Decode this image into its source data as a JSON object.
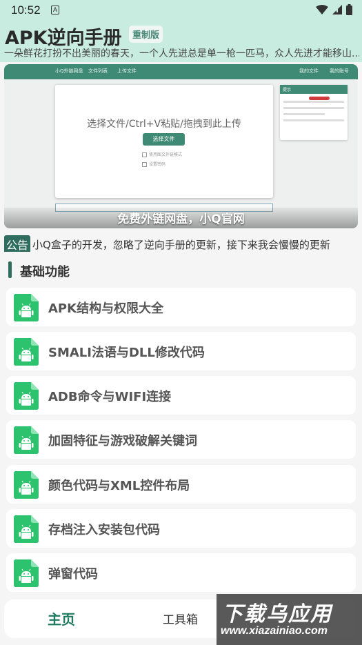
{
  "status_bar": {
    "time": "10:52",
    "notification_glyph": "A",
    "icons": [
      "wifi-icon",
      "signal-icon",
      "battery-icon"
    ]
  },
  "app": {
    "title": "APK逆向手册",
    "badge": "重制版"
  },
  "marquee": "一朵鲜花打扮不出美丽的春天，一个人先进总是单一枪一匹马，众人先进才能移山...",
  "banner": {
    "nav_items": [
      "小Q外链网盘",
      "文件列表",
      "上传文件",
      "我的文件",
      "我的账号"
    ],
    "upload_prompt": "选择文件/Ctrl+V粘贴/拖拽到此上传",
    "upload_button": "选择文件",
    "checkbox_1": "使用图文外链模式",
    "checkbox_2": "设置密码",
    "tip_title": "提示",
    "caption": "免费外链网盘，小Q官网"
  },
  "notice": {
    "tag": "公告",
    "text": "小Q盒子的开发，忽略了逆向手册的更新，接下来我会慢慢的更新"
  },
  "section": {
    "title": "基础功能"
  },
  "features": [
    {
      "label": "APK结构与权限大全",
      "icon": "android-file-icon"
    },
    {
      "label": "SMALI法语与DLL修改代码",
      "icon": "android-file-icon"
    },
    {
      "label": "ADB命令与WIFI连接",
      "icon": "android-file-icon"
    },
    {
      "label": "加固特征与游戏破解关键词",
      "icon": "android-file-icon"
    },
    {
      "label": "颜色代码与XML控件布局",
      "icon": "android-file-icon"
    },
    {
      "label": "存档注入安装包代码",
      "icon": "android-file-icon"
    },
    {
      "label": "弹窗代码",
      "icon": "android-file-icon"
    }
  ],
  "bottom_nav": {
    "home": "主页",
    "tools": "工具箱"
  },
  "watermark": {
    "text": "下载乌应用",
    "url": "www.xiazainiao.com"
  },
  "colors": {
    "accent": "#2f6e5e",
    "top_bg": "#c9ece0",
    "icon_green": "#2dc36e"
  }
}
